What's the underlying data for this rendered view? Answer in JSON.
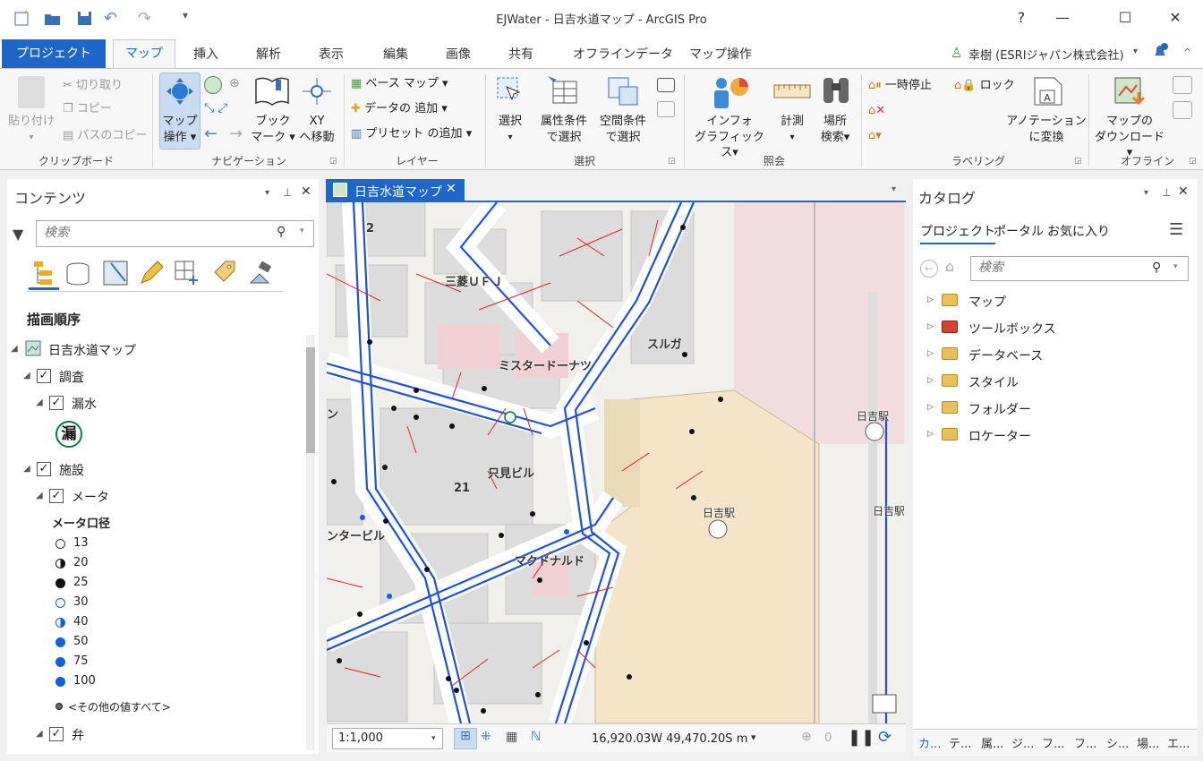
{
  "app": {
    "title": "EJWater - 日吉水道マップ - ArcGIS Pro"
  },
  "window": {
    "help": "?",
    "minimize": "—",
    "maximize": "☐",
    "close": "✕"
  },
  "tabs": {
    "project": "プロジェクト",
    "items": [
      "マップ",
      "挿入",
      "解析",
      "表示",
      "編集",
      "画像",
      "共有",
      "オフラインデータ",
      "マップ操作"
    ]
  },
  "user": {
    "name": "幸樹 (ESRIジャパン株式会社)"
  },
  "ribbon": {
    "clipboard": {
      "paste": "貼り付け",
      "cut": "切り取り",
      "copy": "コピー",
      "copy_path": "パスのコピー",
      "group": "クリップボード"
    },
    "navigation": {
      "explore": "マップ操作",
      "bookmark": "ブックマーク",
      "xy": "XYへ移動",
      "xy_line1": "XY",
      "xy_line2": "へ移動",
      "bm_line1": "ブック",
      "bm_line2": "マーク",
      "exp_line1": "マップ",
      "exp_line2": "操作",
      "group": "ナビゲーション"
    },
    "layer": {
      "basemap": "ベース マップ",
      "add_data": "データの 追加",
      "add_preset": "プリセット の追加",
      "group": "レイヤー"
    },
    "selection": {
      "select": "選択",
      "by_attr1": "属性条件",
      "by_attr2": "で選択",
      "by_loc1": "空間条件",
      "by_loc2": "で選択",
      "group": "選択"
    },
    "inquiry": {
      "infographics1": "インフォ",
      "infographics2": "グラフィックス",
      "measure": "計測",
      "locate1": "場所",
      "locate2": "検索",
      "group": "照会"
    },
    "labeling": {
      "pause": "一時停止",
      "lock": "ロック",
      "convert1": "アノテーション",
      "convert2": "に変換",
      "group": "ラベリング"
    },
    "offline": {
      "download1": "マップの",
      "download2": "ダウンロード",
      "group": "オフライン"
    }
  },
  "contents": {
    "title": "コンテンツ",
    "search_placeholder": "検索",
    "section": "描画順序",
    "map": "日吉水道マップ",
    "layers": {
      "survey": "調査",
      "leak": "漏水",
      "leak_symbol": "漏",
      "facility": "施設",
      "meter": "メータ",
      "meter_field": "メータ口径",
      "valve": "弁"
    },
    "legend": [
      {
        "label": "13",
        "style": "empty"
      },
      {
        "label": "20",
        "style": "half"
      },
      {
        "label": "25",
        "style": "black"
      },
      {
        "label": "30",
        "style": "blue-ring"
      },
      {
        "label": "40",
        "style": "blue-half"
      },
      {
        "label": "50",
        "style": "blue"
      },
      {
        "label": "75",
        "style": "blue"
      },
      {
        "label": "100",
        "style": "blue"
      }
    ],
    "other": "<その他の値すべて>"
  },
  "mapview": {
    "tab": "日吉水道マップ",
    "labels": [
      "2",
      "三菱ＵＦＪ",
      "スルガ",
      "ミスタードーナツ",
      "只見ビル",
      "21",
      "ンタービル",
      "マクドナルド",
      "日吉駅",
      "日吉駅",
      "日吉駅",
      "ン"
    ],
    "scale": "1:1,000",
    "coords": "16,920.03W 49,470.20S m",
    "selected_count": "0"
  },
  "catalog": {
    "title": "カタログ",
    "tabs": [
      "プロジェクト",
      "ポータル",
      "お気に入り"
    ],
    "search_placeholder": "検索",
    "items": [
      "マップ",
      "ツールボックス",
      "データベース",
      "スタイル",
      "フォルダー",
      "ロケーター"
    ],
    "bottom_tabs": [
      "カ...",
      "テ...",
      "属...",
      "ジ...",
      "フ...",
      "フ...",
      "シ...",
      "場...",
      "エ..."
    ]
  },
  "colors": {
    "accent": "#1e66c8",
    "pipe": "#1e4fe0",
    "service": "#e02020"
  }
}
